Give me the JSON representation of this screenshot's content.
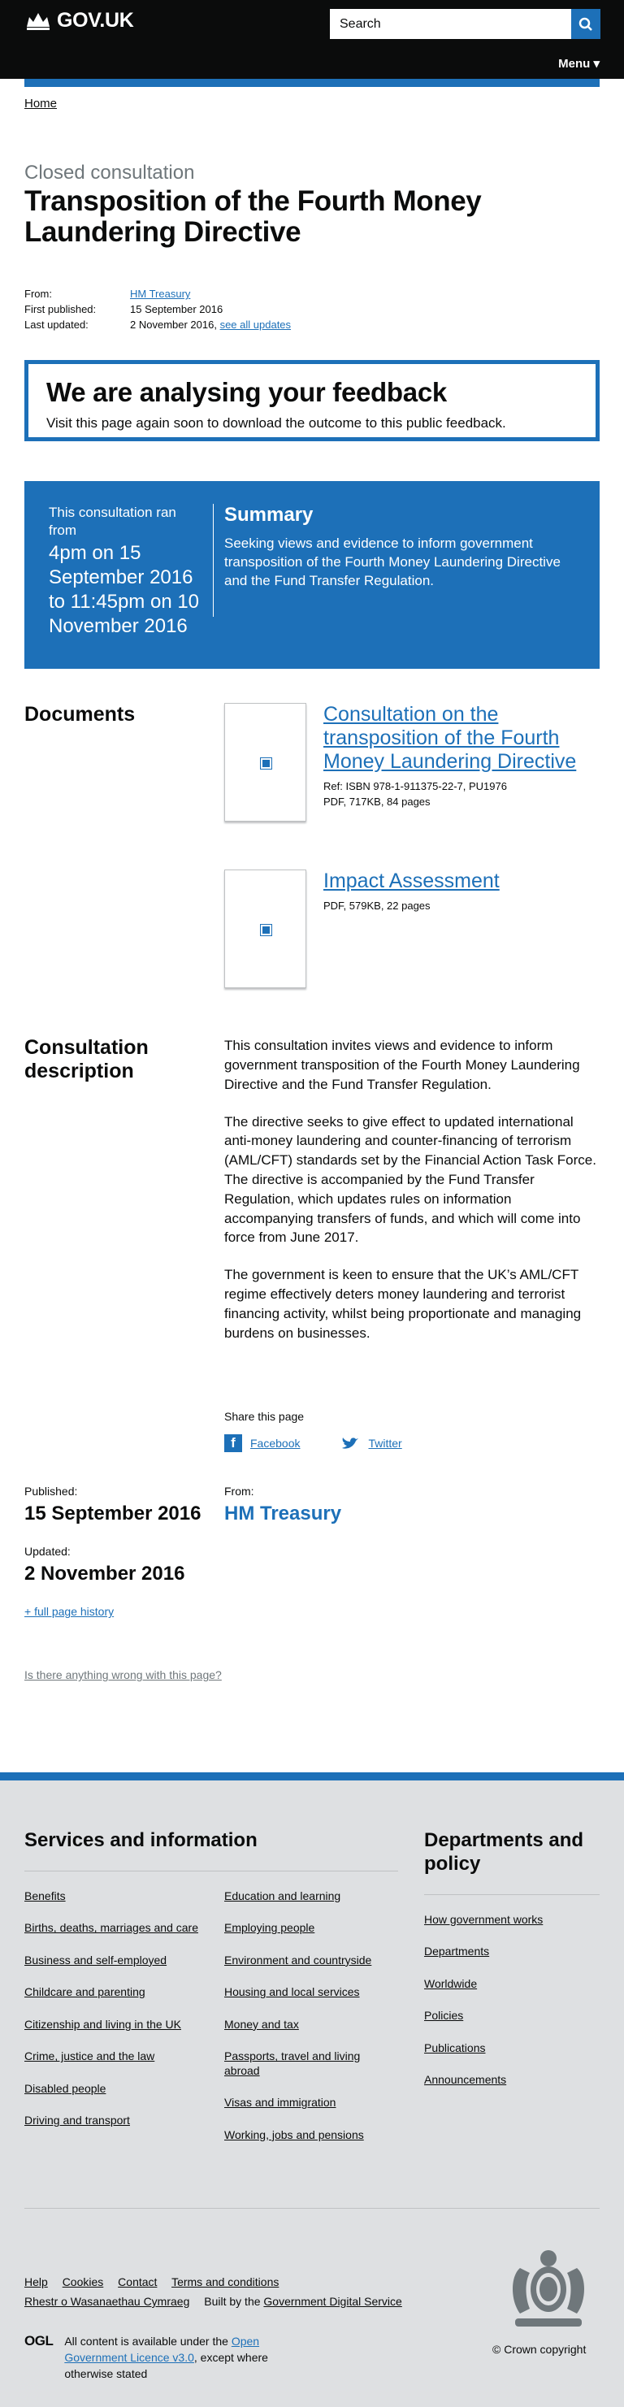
{
  "header": {
    "logo_text": "GOV.UK",
    "search_placeholder": "Search",
    "menu_label": "Menu ▾"
  },
  "breadcrumb": {
    "home": "Home"
  },
  "page": {
    "context": "Closed consultation",
    "title": "Transposition of the Fourth Money Laundering Directive"
  },
  "metadata": {
    "from_label": "From:",
    "from_value": "HM Treasury",
    "first_published_label": "First published:",
    "first_published_value": "15 September 2016",
    "last_updated_label": "Last updated:",
    "last_updated_value": "2 November 2016,",
    "see_all_updates": "see all updates"
  },
  "notice": {
    "heading": "We are analysing your feedback",
    "text": "Visit this page again soon to download the outcome to this public feedback."
  },
  "consultation_banner": {
    "ran_from": "This consultation ran from",
    "dates": "4pm on 15 September 2016 to 11:45pm on 10 November 2016",
    "summary_heading": "Summary",
    "summary_text": "Seeking views and evidence to inform government transposition of the Fourth Money Laundering Directive and the Fund Transfer Regulation."
  },
  "documents": {
    "heading": "Documents",
    "items": [
      {
        "title": "Consultation on the transposition of the Fourth Money Laundering Directive",
        "ref": "Ref: ISBN 978-1-911375-22-7, PU1976",
        "info": "PDF, 717KB, 84 pages"
      },
      {
        "title": "Impact Assessment",
        "ref": "",
        "info": "PDF, 579KB, 22 pages"
      }
    ]
  },
  "description": {
    "heading": "Consultation description",
    "paragraphs": [
      "This consultation invites views and evidence to inform government transposition of the Fourth Money Laundering Directive and the Fund Transfer Regulation.",
      "The directive seeks to give effect to updated international anti-money laundering and counter-financing of terrorism (AML/CFT) standards set by the Financial Action Task Force. The directive is accompanied by the Fund Transfer Regulation, which updates rules on information accompanying transfers of funds, and which will come into force from June 2017.",
      "The government is keen to ensure that the UK’s AML/CFT regime effectively deters money laundering and terrorist financing activity, whilst being proportionate and managing burdens on businesses."
    ]
  },
  "share": {
    "label": "Share this page",
    "facebook": "Facebook",
    "twitter": "Twitter"
  },
  "publication": {
    "published_label": "Published:",
    "published_value": "15 September 2016",
    "updated_label": "Updated:",
    "updated_value": "2 November 2016",
    "from_label": "From:",
    "from_value": "HM Treasury",
    "history_link": "+ full page history",
    "report_link": "Is there anything wrong with this page?"
  },
  "footer": {
    "services_heading": "Services and information",
    "services_col1": [
      "Benefits",
      "Births, deaths, marriages and care",
      "Business and self-employed",
      "Childcare and parenting",
      "Citizenship and living in the UK",
      "Crime, justice and the law",
      "Disabled people",
      "Driving and transport"
    ],
    "services_col2": [
      "Education and learning",
      "Employing people",
      "Environment and countryside",
      "Housing and local services",
      "Money and tax",
      "Passports, travel and living abroad",
      "Visas and immigration",
      "Working, jobs and pensions"
    ],
    "departments_heading": "Departments and policy",
    "departments": [
      "How government works",
      "Departments",
      "Worldwide",
      "Policies",
      "Publications",
      "Announcements"
    ],
    "meta_links_row1": [
      "Help",
      "Cookies",
      "Contact",
      "Terms and conditions"
    ],
    "meta_links_row2": [
      "Rhestr o Wasanaethau Cymraeg"
    ],
    "built_by_prefix": "Built by the",
    "built_by_link": "Government Digital Service",
    "ogl": "OGL",
    "licence_prefix": "All content is available under the",
    "licence_link": "Open Government Licence v3.0",
    "licence_suffix": ", except where otherwise stated",
    "copyright": "© Crown copyright"
  }
}
